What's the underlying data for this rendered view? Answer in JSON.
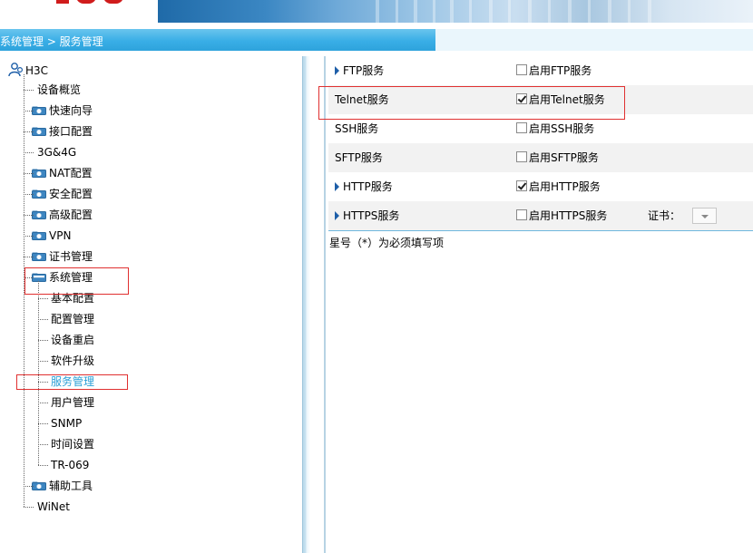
{
  "breadcrumb": "系统管理 > 服务管理",
  "tree": {
    "root": "H3C",
    "items": [
      {
        "label": "设备概览",
        "folder": false
      },
      {
        "label": "快速向导",
        "folder": true
      },
      {
        "label": "接口配置",
        "folder": true
      },
      {
        "label": "3G&4G",
        "folder": false
      },
      {
        "label": "NAT配置",
        "folder": true
      },
      {
        "label": "安全配置",
        "folder": true
      },
      {
        "label": "高级配置",
        "folder": true
      },
      {
        "label": "VPN",
        "folder": true
      },
      {
        "label": "证书管理",
        "folder": true
      },
      {
        "label": "系统管理",
        "folder": true,
        "open": true
      },
      {
        "label": "辅助工具",
        "folder": true
      },
      {
        "label": "WiNet",
        "folder": false
      }
    ],
    "system_children": [
      "基本配置",
      "配置管理",
      "设备重启",
      "软件升级",
      "服务管理",
      "用户管理",
      "SNMP",
      "时间设置",
      "TR-069"
    ],
    "active_child": "服务管理"
  },
  "services": [
    {
      "name": "FTP服务",
      "arrow": true,
      "checkbox_label": "启用FTP服务",
      "checked": false
    },
    {
      "name": "Telnet服务",
      "arrow": false,
      "checkbox_label": "启用Telnet服务",
      "checked": true
    },
    {
      "name": "SSH服务",
      "arrow": false,
      "checkbox_label": "启用SSH服务",
      "checked": false
    },
    {
      "name": "SFTP服务",
      "arrow": false,
      "checkbox_label": "启用SFTP服务",
      "checked": false
    },
    {
      "name": "HTTP服务",
      "arrow": true,
      "checkbox_label": "启用HTTP服务",
      "checked": true
    },
    {
      "name": "HTTPS服务",
      "arrow": true,
      "checkbox_label": "启用HTTPS服务",
      "checked": false,
      "cert_label": "证书：",
      "cert_value": ""
    }
  ],
  "required_note": "星号（*）为必须填写项",
  "colors": {
    "breadcrumb_bg": "#39aee6",
    "active_link": "#2a9fd6",
    "highlight_box": "#e03030",
    "row_shade": "#f2f2f2"
  }
}
